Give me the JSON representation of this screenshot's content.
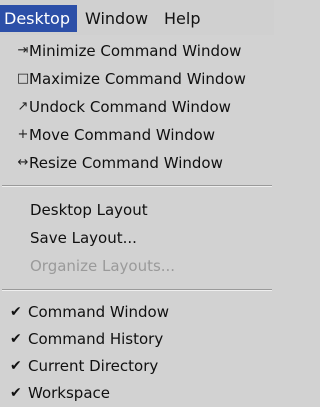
{
  "menubar": {
    "items": [
      {
        "label": "Desktop",
        "active": true
      },
      {
        "label": "Window",
        "active": false
      },
      {
        "label": "Help",
        "active": false
      }
    ]
  },
  "desktop_menu": {
    "window_actions": [
      {
        "icon": "minimize-icon",
        "glyph": "⇥",
        "label": "Minimize Command Window"
      },
      {
        "icon": "maximize-icon",
        "glyph": "□",
        "label": "Maximize Command Window"
      },
      {
        "icon": "undock-icon",
        "glyph": "↗",
        "label": "Undock Command Window"
      },
      {
        "icon": "move-icon",
        "glyph": "+",
        "label": "Move Command Window"
      },
      {
        "icon": "resize-icon",
        "glyph": "↔",
        "label": "Resize Command Window"
      }
    ],
    "layout_actions": [
      {
        "label": "Desktop Layout",
        "enabled": true
      },
      {
        "label": "Save Layout...",
        "enabled": true
      },
      {
        "label": "Organize Layouts...",
        "enabled": false
      }
    ],
    "tool_windows": [
      {
        "label": "Command Window",
        "checked": true
      },
      {
        "label": "Command History",
        "checked": true
      },
      {
        "label": "Current Directory",
        "checked": true
      },
      {
        "label": "Workspace",
        "checked": true
      }
    ],
    "check_glyph": "✔"
  },
  "colors": {
    "menu_bg": "#d2d2d2",
    "active_menu_bg": "#2c4fa8",
    "disabled_text": "#9a9a9a"
  }
}
